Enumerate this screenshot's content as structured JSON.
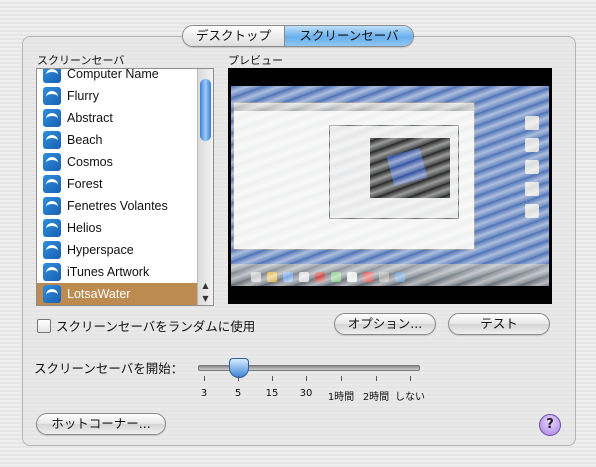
{
  "tabs": [
    {
      "label": "デスクトップ",
      "selected": false
    },
    {
      "label": "スクリーンセーバ",
      "selected": true
    }
  ],
  "list": {
    "title": "スクリーンセーバ",
    "items": [
      "Computer Name",
      "Flurry",
      "Abstract",
      "Beach",
      "Cosmos",
      "Forest",
      "Fenetres Volantes",
      "Helios",
      "Hyperspace",
      "iTunes Artwork",
      "LotsaWater"
    ],
    "selected": "LotsaWater"
  },
  "preview": {
    "title": "プレビュー"
  },
  "random_checkbox": {
    "label": "スクリーンセーバをランダムに使用",
    "checked": false
  },
  "options_button": "オプション...",
  "test_button": "テスト",
  "start": {
    "label": "スクリーンセーバを開始：",
    "ticks": [
      "3",
      "5",
      "15",
      "30",
      "1時間",
      "2時間",
      "しない"
    ],
    "value": "5"
  },
  "hot_corners_button": "ホットコーナー...",
  "help": "?",
  "colors": {
    "selection": "#bd8a4f",
    "tab_selected": "#6ab0ec",
    "help": "#a77fe0"
  }
}
